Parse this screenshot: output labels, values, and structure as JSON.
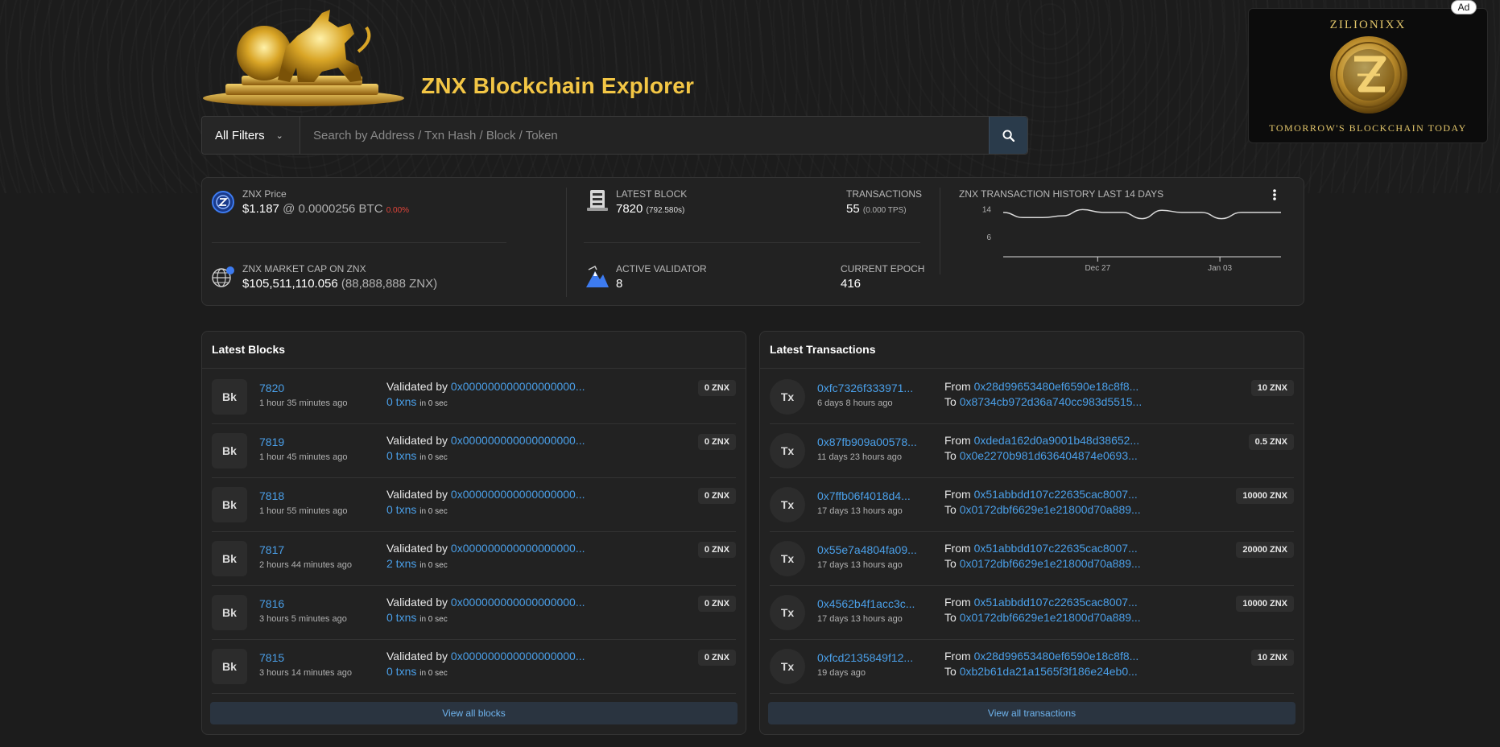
{
  "header": {
    "title": "ZNX Blockchain Explorer",
    "filter_label": "All Filters",
    "search_placeholder": "Search by Address / Txn Hash / Block / Token"
  },
  "ad": {
    "badge": "Ad",
    "brand": "ZILIONIXX",
    "tagline": "TOMORROW'S BLOCKCHAIN TODAY"
  },
  "stats": {
    "price_label": "ZNX Price",
    "price_value": "$1.187",
    "price_btc": "@ 0.0000256 BTC",
    "price_change": "0.00%",
    "marketcap_label": "ZNX MARKET CAP ON ZNX",
    "marketcap_value": "$105,511,110.056",
    "marketcap_supply": "(88,888,888 ZNX)",
    "latest_block_label": "LATEST BLOCK",
    "latest_block_value": "7820",
    "latest_block_time": "(792.580s)",
    "transactions_label": "TRANSACTIONS",
    "transactions_value": "55",
    "transactions_tps": "(0.000 TPS)",
    "validator_label": "ACTIVE VALIDATOR",
    "validator_value": "8",
    "epoch_label": "CURRENT EPOCH",
    "epoch_value": "416"
  },
  "chart_data": {
    "type": "line",
    "title": "ZNX TRANSACTION HISTORY LAST 14 DAYS",
    "y_ticks": [
      "14",
      "6"
    ],
    "x_ticks": [
      "Dec 27",
      "Jan 03"
    ],
    "ylim": [
      2,
      16
    ],
    "values": [
      13,
      11.5,
      11.5,
      12,
      13.8,
      13,
      13,
      11.2,
      13.6,
      13,
      13,
      11.2,
      13,
      13,
      13
    ]
  },
  "blocks": {
    "title": "Latest Blocks",
    "view_all": "View all blocks",
    "items": [
      {
        "tile": "Bk",
        "number": "7820",
        "age": "1 hour 35 minutes ago",
        "validated_label": "Validated by",
        "validator": "0x000000000000000000...",
        "txns": "0 txns",
        "time": "in 0 sec",
        "amount": "0 ZNX"
      },
      {
        "tile": "Bk",
        "number": "7819",
        "age": "1 hour 45 minutes ago",
        "validated_label": "Validated by",
        "validator": "0x000000000000000000...",
        "txns": "0 txns",
        "time": "in 0 sec",
        "amount": "0 ZNX"
      },
      {
        "tile": "Bk",
        "number": "7818",
        "age": "1 hour 55 minutes ago",
        "validated_label": "Validated by",
        "validator": "0x000000000000000000...",
        "txns": "0 txns",
        "time": "in 0 sec",
        "amount": "0 ZNX"
      },
      {
        "tile": "Bk",
        "number": "7817",
        "age": "2 hours 44 minutes ago",
        "validated_label": "Validated by",
        "validator": "0x000000000000000000...",
        "txns": "2 txns",
        "time": "in 0 sec",
        "amount": "0 ZNX"
      },
      {
        "tile": "Bk",
        "number": "7816",
        "age": "3 hours 5 minutes ago",
        "validated_label": "Validated by",
        "validator": "0x000000000000000000...",
        "txns": "0 txns",
        "time": "in 0 sec",
        "amount": "0 ZNX"
      },
      {
        "tile": "Bk",
        "number": "7815",
        "age": "3 hours 14 minutes ago",
        "validated_label": "Validated by",
        "validator": "0x000000000000000000...",
        "txns": "0 txns",
        "time": "in 0 sec",
        "amount": "0 ZNX"
      }
    ]
  },
  "transactions": {
    "title": "Latest Transactions",
    "view_all": "View all transactions",
    "items": [
      {
        "tile": "Tx",
        "hash": "0xfc7326f333971...",
        "age": "6 days 8 hours ago",
        "from_label": "From",
        "from": "0x28d99653480ef6590e18c8f8...",
        "to_label": "To",
        "to": "0x8734cb972d36a740cc983d5515...",
        "amount": "10 ZNX"
      },
      {
        "tile": "Tx",
        "hash": "0x87fb909a00578...",
        "age": "11 days 23 hours ago",
        "from_label": "From",
        "from": "0xdeda162d0a9001b48d38652...",
        "to_label": "To",
        "to": "0x0e2270b981d636404874e0693...",
        "amount": "0.5 ZNX"
      },
      {
        "tile": "Tx",
        "hash": "0x7ffb06f4018d4...",
        "age": "17 days 13 hours ago",
        "from_label": "From",
        "from": "0x51abbdd107c22635cac8007...",
        "to_label": "To",
        "to": "0x0172dbf6629e1e21800d70a889...",
        "amount": "10000 ZNX"
      },
      {
        "tile": "Tx",
        "hash": "0x55e7a4804fa09...",
        "age": "17 days 13 hours ago",
        "from_label": "From",
        "from": "0x51abbdd107c22635cac8007...",
        "to_label": "To",
        "to": "0x0172dbf6629e1e21800d70a889...",
        "amount": "20000 ZNX"
      },
      {
        "tile": "Tx",
        "hash": "0x4562b4f1acc3c...",
        "age": "17 days 13 hours ago",
        "from_label": "From",
        "from": "0x51abbdd107c22635cac8007...",
        "to_label": "To",
        "to": "0x0172dbf6629e1e21800d70a889...",
        "amount": "10000 ZNX"
      },
      {
        "tile": "Tx",
        "hash": "0xfcd2135849f12...",
        "age": "19 days ago",
        "from_label": "From",
        "from": "0x28d99653480ef6590e18c8f8...",
        "to_label": "To",
        "to": "0xb2b61da21a1565f3f186e24eb0...",
        "amount": "10 ZNX"
      }
    ]
  },
  "colors": {
    "accent": "#f3c645",
    "link": "#4a9fe8",
    "negative": "#e0443a",
    "background": "#1c1c1c",
    "panel": "#222222"
  },
  "icons": {
    "search": "search-icon",
    "price": "znx-coin-icon",
    "marketcap": "globe-icon",
    "block": "server-icon",
    "validator": "mountain-icon",
    "menu": "kebab-menu-icon"
  }
}
